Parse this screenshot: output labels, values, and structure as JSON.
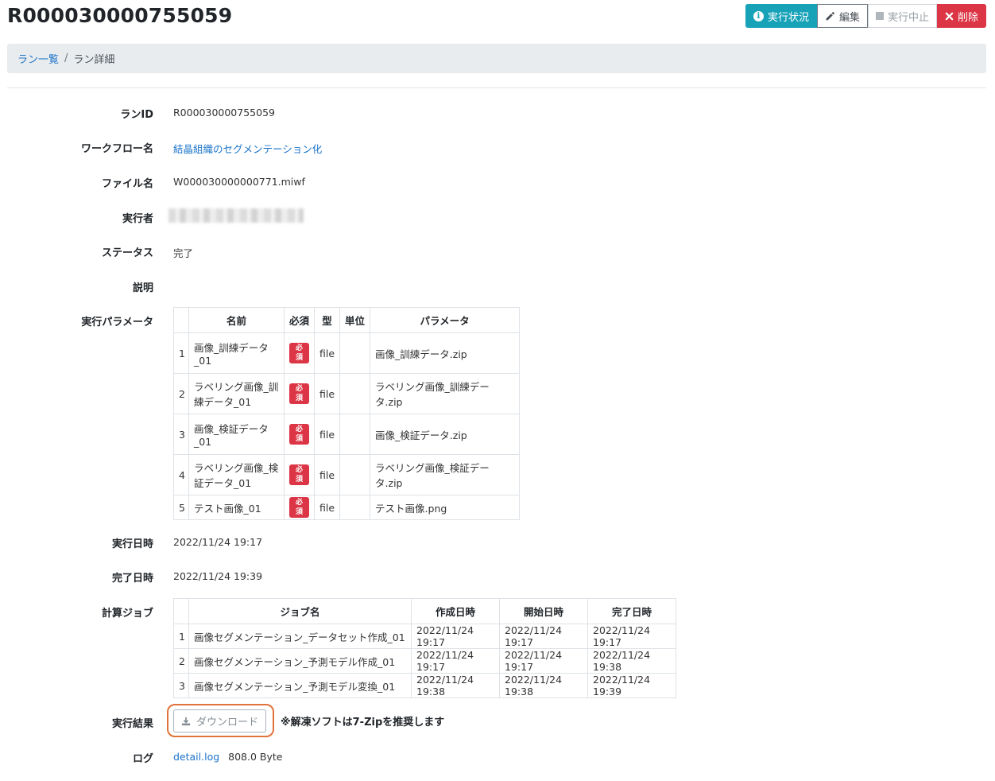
{
  "header": {
    "title": "R000030000755059",
    "buttons": {
      "status": "実行状況",
      "edit": "編集",
      "stop": "実行中止",
      "delete": "削除"
    }
  },
  "breadcrumb": {
    "list": "ラン一覧",
    "separator": "/",
    "current": "ラン詳細"
  },
  "details": {
    "run_id_label": "ランID",
    "run_id": "R000030000755059",
    "workflow_label": "ワークフロー名",
    "workflow": "結晶組織のセグメンテーション化",
    "file_label": "ファイル名",
    "file": "W000030000000771.miwf",
    "executor_label": "実行者",
    "status_label": "ステータス",
    "status": "完了",
    "description_label": "説明",
    "params_label": "実行パラメータ",
    "exec_time_label": "実行日時",
    "exec_time": "2022/11/24 19:17",
    "done_time_label": "完了日時",
    "done_time": "2022/11/24 19:39",
    "jobs_label": "計算ジョブ",
    "result_label": "実行結果",
    "download": "ダウンロード",
    "note": "※解凍ソフトは7-Zipを推奨します",
    "log_label": "ログ",
    "log_link": "detail.log",
    "log_size": "808.0 Byte"
  },
  "params_table": {
    "headers": [
      "名前",
      "必須",
      "型",
      "単位",
      "パラメータ"
    ],
    "required_badge": "必須",
    "rows": [
      {
        "idx": "1",
        "name_l1": "画像_訓練データ",
        "name_l2": "_01",
        "type": "file",
        "unit": "",
        "param": "画像_訓練データ.zip"
      },
      {
        "idx": "2",
        "name_l1": "ラベリング画像_訓",
        "name_l2": "練データ_01",
        "type": "file",
        "unit": "",
        "param": "ラベリング画像_訓練データ.zip"
      },
      {
        "idx": "3",
        "name_l1": "画像_検証データ",
        "name_l2": "_01",
        "type": "file",
        "unit": "",
        "param": "画像_検証データ.zip"
      },
      {
        "idx": "4",
        "name_l1": "ラベリング画像_検",
        "name_l2": "証データ_01",
        "type": "file",
        "unit": "",
        "param": "ラベリング画像_検証データ.zip"
      },
      {
        "idx": "5",
        "name_l1": "テスト画像_01",
        "name_l2": "",
        "type": "file",
        "unit": "",
        "param": "テスト画像.png"
      }
    ]
  },
  "jobs_table": {
    "headers": [
      "ジョブ名",
      "作成日時",
      "開始日時",
      "完了日時"
    ],
    "rows": [
      {
        "idx": "1",
        "name": "画像セグメンテーション_データセット作成_01",
        "created": "2022/11/24 19:17",
        "started": "2022/11/24 19:17",
        "finished": "2022/11/24 19:17"
      },
      {
        "idx": "2",
        "name": "画像セグメンテーション_予測モデル作成_01",
        "created": "2022/11/24 19:17",
        "started": "2022/11/24 19:17",
        "finished": "2022/11/24 19:38"
      },
      {
        "idx": "3",
        "name": "画像セグメンテーション_予測モデル変換_01",
        "created": "2022/11/24 19:38",
        "started": "2022/11/24 19:38",
        "finished": "2022/11/24 19:39"
      }
    ]
  },
  "colors": {
    "info": "#17a2b8",
    "danger": "#dc3545",
    "link": "#1a73c9",
    "highlight_ring": "#e0733a"
  }
}
